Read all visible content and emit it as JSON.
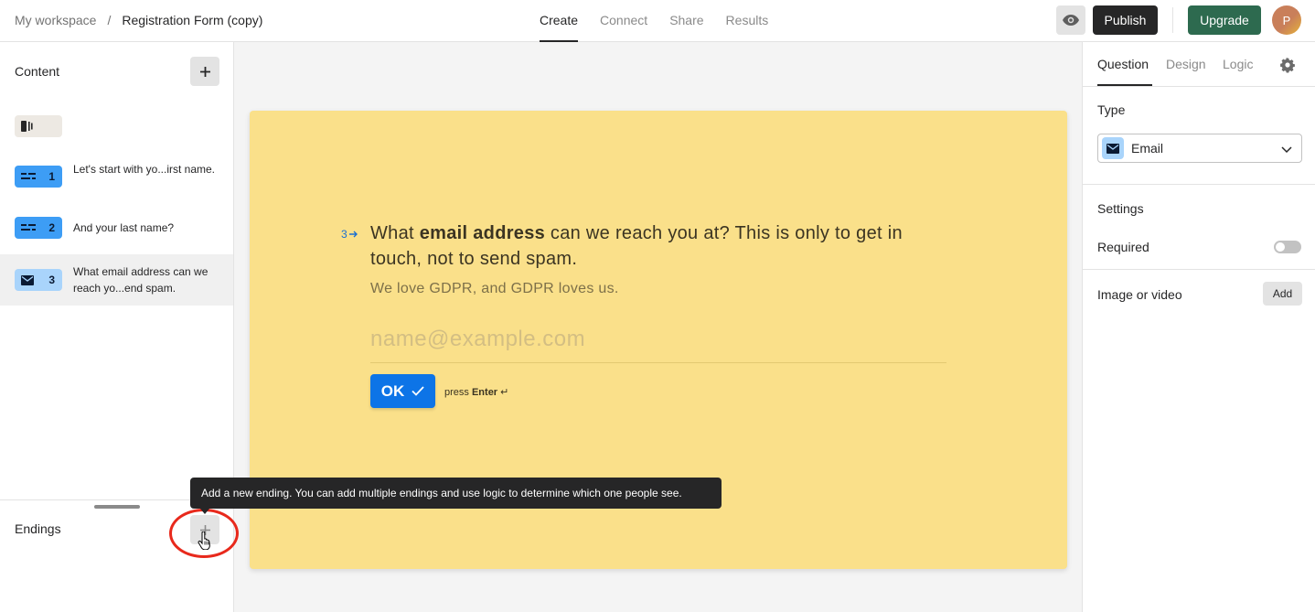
{
  "breadcrumb": {
    "workspace": "My workspace",
    "separator": "/",
    "form": "Registration Form (copy)"
  },
  "nav_tabs": [
    {
      "label": "Create",
      "active": true
    },
    {
      "label": "Connect",
      "active": false
    },
    {
      "label": "Share",
      "active": false
    },
    {
      "label": "Results",
      "active": false
    }
  ],
  "header": {
    "publish": "Publish",
    "upgrade": "Upgrade",
    "avatar_initial": "P",
    "preview_icon": "eye-icon"
  },
  "sidebar": {
    "content_title": "Content",
    "add_icon": "plus-icon",
    "questions": [
      {
        "number": "1",
        "text": "Let's start with yo...irst name.",
        "icon": "short-text-icon"
      },
      {
        "number": "2",
        "text": "And your last name?",
        "icon": "short-text-icon"
      },
      {
        "number": "3",
        "text": "What email address can we reach yo...end spam.",
        "icon": "envelope-icon",
        "selected": true
      }
    ],
    "endings_title": "Endings"
  },
  "tooltip": "Add a new ending. You can add multiple endings and use logic to determine which one people see.",
  "question": {
    "number": "3",
    "title_pre": "What ",
    "title_bold": "email address",
    "title_post": " can we reach you at? This is only to get in touch, not to send spam.",
    "description": "We love GDPR, and GDPR loves us.",
    "placeholder": "name@example.com",
    "ok": "OK",
    "press": "press",
    "enter": "Enter",
    "enter_glyph": "↵"
  },
  "panel": {
    "tabs": [
      "Question",
      "Design",
      "Logic"
    ],
    "active_tab": "Question",
    "type_label": "Type",
    "type_value": "Email",
    "settings_label": "Settings",
    "required_label": "Required",
    "required_on": false,
    "media_label": "Image or video",
    "media_add": "Add"
  },
  "colors": {
    "card_bg": "#fae08a",
    "ok_button": "#0d74e7",
    "upgrade": "#2d6a4f",
    "highlight_circle": "#e8291c"
  }
}
